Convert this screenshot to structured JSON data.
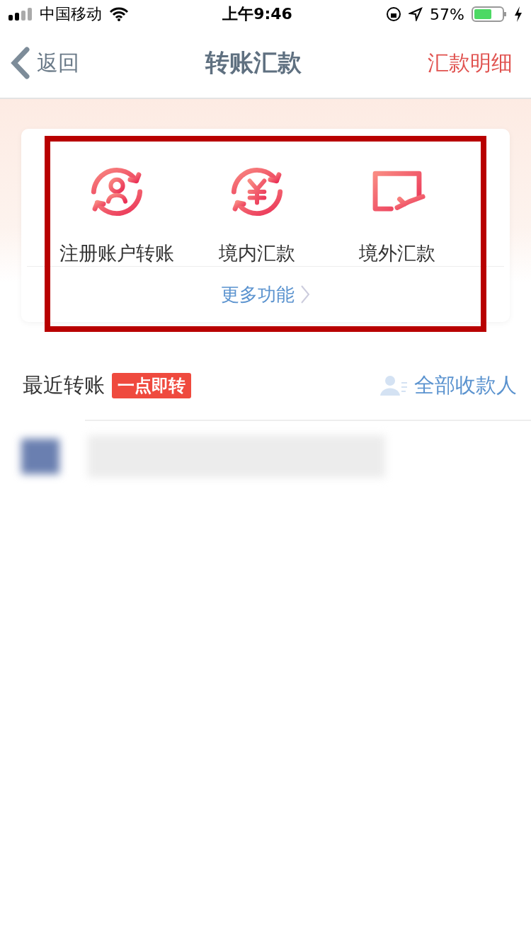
{
  "status_bar": {
    "carrier": "中国移动",
    "time": "上午9:46",
    "battery": "57%"
  },
  "nav": {
    "back": "返回",
    "title": "转账汇款",
    "action": "汇款明细"
  },
  "services": [
    {
      "kind": "person",
      "label": "注册账户转账"
    },
    {
      "kind": "yuan",
      "label": "境内汇款"
    },
    {
      "kind": "card",
      "label": "境外汇款"
    }
  ],
  "more": "更多功能",
  "recent": {
    "title": "最近转账",
    "badge": "一点即转",
    "all_payees": "全部收款人"
  },
  "annotation": {
    "highlighted": true
  }
}
